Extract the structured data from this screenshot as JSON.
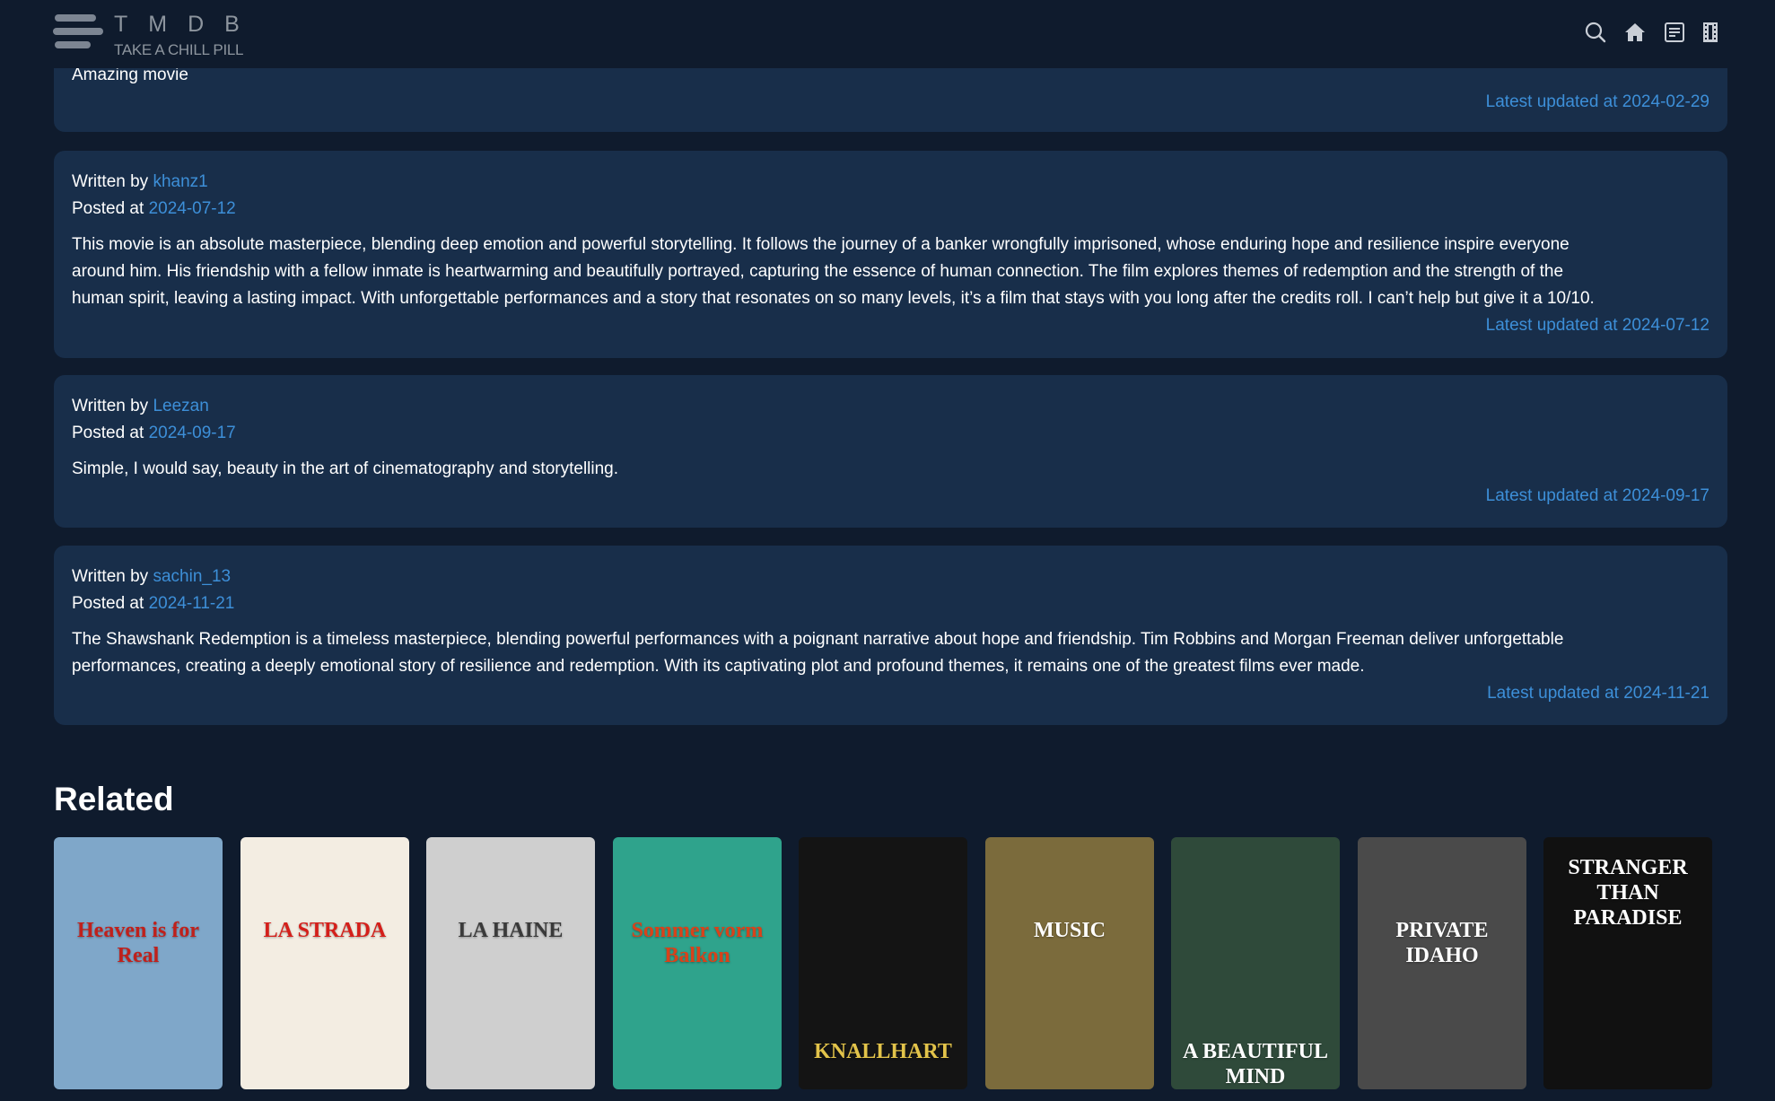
{
  "brand": {
    "title": "TMDB",
    "tagline": "TAKE A CHILL PILL"
  },
  "nav_icons": [
    "search-icon",
    "home-icon",
    "list-icon",
    "film-icon"
  ],
  "labels": {
    "written_by": "Written by",
    "posted_at": "Posted at",
    "latest_updated": "Latest updated at"
  },
  "reviews": [
    {
      "text": "Amazing movie",
      "updated": "2024-02-29"
    },
    {
      "author": "khanz1",
      "posted": "2024-07-12",
      "text_lines": [
        "This movie is an absolute masterpiece, blending deep emotion and powerful storytelling. It follows the journey of a banker wrongfully imprisoned, whose enduring hope and resilience inspire everyone",
        "around him. His friendship with a fellow inmate is heartwarming and beautifully portrayed, capturing the essence of human connection. The film explores themes of redemption and the strength of the",
        "human spirit, leaving a lasting impact. With unforgettable performances and a story that resonates on so many levels, it’s a film that stays with you long after the credits roll. I can’t help but give it a 10/10."
      ],
      "updated": "2024-07-12"
    },
    {
      "author": "Leezan",
      "posted": "2024-09-17",
      "text_lines": [
        "Simple, I would say, beauty in the art of cinematography and storytelling."
      ],
      "updated": "2024-09-17"
    },
    {
      "author": "sachin_13",
      "posted": "2024-11-21",
      "text_lines": [
        "The Shawshank Redemption is a timeless masterpiece, blending powerful performances with a poignant narrative about hope and friendship. Tim Robbins and Morgan Freeman deliver unforgettable",
        "performances, creating a deeply emotional story of resilience and redemption. With its captivating plot and profound themes, it remains one of the greatest films ever made."
      ],
      "updated": "2024-11-21"
    }
  ],
  "related": {
    "heading": "Related",
    "posters": [
      {
        "title": "Heaven is for Real",
        "bg": "#7fa7c9",
        "fg": "#c0201b"
      },
      {
        "title": "LA STRADA",
        "bg": "#f3ede2",
        "fg": "#d41f1a"
      },
      {
        "title": "LA HAINE",
        "bg": "#cfcfcf",
        "fg": "#3a3a3a"
      },
      {
        "title": "Sommer vorm Balkon",
        "bg": "#2fa38c",
        "fg": "#d9421a"
      },
      {
        "title": "KNALLHART",
        "bg": "#141414",
        "fg": "#e2c34a"
      },
      {
        "title": "MUSIC",
        "bg": "#7b6b3c",
        "fg": "#ffffff"
      },
      {
        "title": "A BEAUTIFUL MIND",
        "bg": "#2f4a3a",
        "fg": "#ffffff"
      },
      {
        "title": "PRIVATE IDAHO",
        "bg": "#4a4a4a",
        "fg": "#ffffff"
      },
      {
        "title": "STRANGER THAN PARADISE",
        "bg": "#111111",
        "fg": "#ffffff"
      }
    ]
  }
}
